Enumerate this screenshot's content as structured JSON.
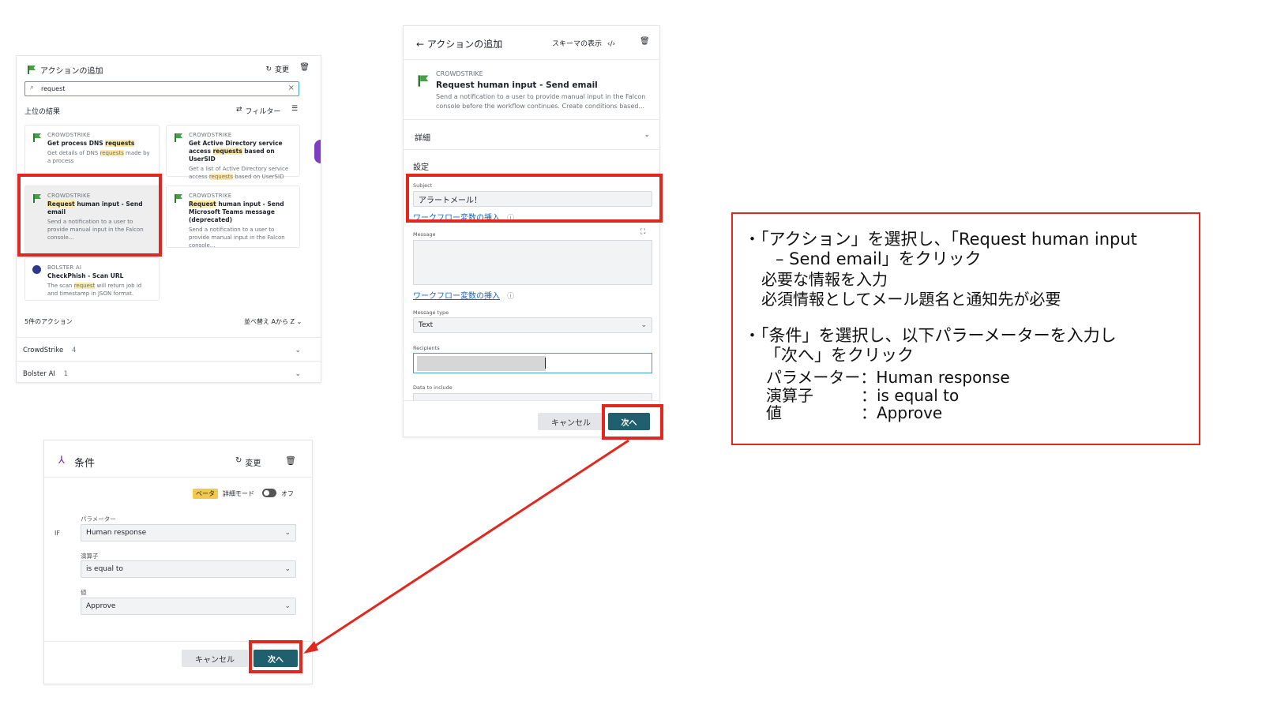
{
  "panel_a": {
    "title": "アクションの追加",
    "change_label": "変更",
    "search_value": "request",
    "top_results_label": "上位の結果",
    "filter_label": "フィルター",
    "cards": [
      {
        "vendor": "CROWDSTRIKE",
        "title_pre": "Get process DNS ",
        "title_hl": "requests",
        "title_post": "",
        "desc_pre": "Get details of DNS ",
        "desc_hl": "requests",
        "desc_post": " made by a process"
      },
      {
        "vendor": "CROWDSTRIKE",
        "title_pre": "Get Active Directory service access ",
        "title_hl": "requests",
        "title_post": " based on UserSID",
        "desc_pre": "Get a list of Active Directory service access ",
        "desc_hl": "requests",
        "desc_post": " based on UserSID"
      },
      {
        "vendor": "CROWDSTRIKE",
        "title_pre": "",
        "title_hl": "Request",
        "title_post": " human input - Send email",
        "desc_pre": "Send a notification to a user to provide manual input in the Falcon console...",
        "desc_hl": "",
        "desc_post": ""
      },
      {
        "vendor": "CROWDSTRIKE",
        "title_pre": "",
        "title_hl": "Request",
        "title_post": " human input - Send Microsoft Teams message (deprecated)",
        "desc_pre": "Send a notification to a user to provide manual input in the Falcon console...",
        "desc_hl": "",
        "desc_post": ""
      },
      {
        "vendor": "BOLSTER AI",
        "title_pre": "CheckPhish - Scan URL",
        "title_hl": "",
        "title_post": "",
        "desc_pre": "The scan ",
        "desc_hl": "request",
        "desc_post": " will return job id and timestamp in JSON format."
      }
    ],
    "actions_count_label": "5件のアクション",
    "sort_label": "並べ替え Aから Z",
    "groups": [
      {
        "name": "CrowdStrike",
        "count": "4"
      },
      {
        "name": "Bolster AI",
        "count": "1"
      }
    ]
  },
  "panel_b": {
    "back_title": "← アクションの追加",
    "schema_label": "スキーマの表示",
    "vendor": "CROWDSTRIKE",
    "action_title": "Request human input - Send email",
    "action_desc": "Send a notification to a user to provide manual input in the Falcon console before the workflow continues. Create conditions based...",
    "details_label": "詳細",
    "settings_label": "設定",
    "subject_label": "Subject",
    "subject_value": "アラートメール！",
    "insert_var_link": "ワークフロー変数の挿入",
    "message_label": "Message",
    "message_type_label": "Message type",
    "message_type_value": "Text",
    "recipients_label": "Recipients",
    "data_include_label": "Data to include",
    "cancel_label": "キャンセル",
    "next_label": "次へ"
  },
  "panel_c": {
    "title": "条件",
    "change_label": "変更",
    "beta_label": "ベータ",
    "detail_mode_label": "詳細モード",
    "toggle_state": "オフ",
    "if_label": "IF",
    "param_label": "パラメーター",
    "param_value": "Human response",
    "operator_label": "演算子",
    "operator_value": "is equal to",
    "value_label": "値",
    "value_value": "Approve",
    "cancel_label": "キャンセル",
    "next_label": "次へ"
  },
  "notes": {
    "bullet1_line1": "・「アクション」を選択し、「Request human input",
    "bullet1_line2": "– Send email」をクリック",
    "bullet1_sub1": "必要な情報を入力",
    "bullet1_sub2": "必須情報としてメール題名と通知先が必要",
    "bullet2_line1": "・「条件」を選択し、以下パラーメーターを入力し",
    "bullet2_line2": "「次へ」をクリック",
    "param_row": "パラメーター：Human response",
    "operator_row": "演算子　　　：is equal to",
    "value_row": "値　　　　　：Approve"
  },
  "colors": {
    "highlight_red": "#e0281e",
    "teal_button": "#1f5f6e",
    "link_blue": "#1565c0"
  }
}
